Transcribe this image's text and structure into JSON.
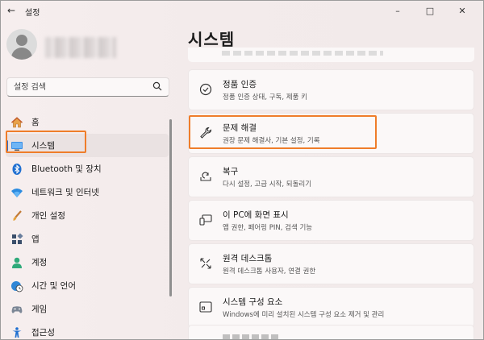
{
  "window": {
    "title": "설정"
  },
  "search": {
    "placeholder": "설정 검색"
  },
  "sidebar": {
    "items": [
      {
        "label": "홈",
        "icon": "home-icon",
        "active": false
      },
      {
        "label": "시스템",
        "icon": "system-display-icon",
        "active": true
      },
      {
        "label": "Bluetooth 및 장치",
        "icon": "bluetooth-icon",
        "active": false
      },
      {
        "label": "네트워크 및 인터넷",
        "icon": "wifi-icon",
        "active": false
      },
      {
        "label": "개인 설정",
        "icon": "brush-icon",
        "active": false
      },
      {
        "label": "앱",
        "icon": "apps-icon",
        "active": false
      },
      {
        "label": "계정",
        "icon": "account-icon",
        "active": false
      },
      {
        "label": "시간 및 언어",
        "icon": "globe-clock-icon",
        "active": false
      },
      {
        "label": "게임",
        "icon": "gamepad-icon",
        "active": false
      },
      {
        "label": "접근성",
        "icon": "accessibility-icon",
        "active": false
      }
    ]
  },
  "main": {
    "title": "시스템",
    "cards": [
      {
        "title": "정품 인증",
        "subtitle": "정품 인증 상태, 구독, 제품 키",
        "icon": "check-circle-icon"
      },
      {
        "title": "문제 해결",
        "subtitle": "권장 문제 해결사, 기본 설정, 기록",
        "icon": "wrench-icon"
      },
      {
        "title": "복구",
        "subtitle": "다시 설정, 고급 시작, 되돌리기",
        "icon": "recovery-icon"
      },
      {
        "title": "이 PC에 화면 표시",
        "subtitle": "앱 권한, 페어링 PIN, 검색 기능",
        "icon": "project-screen-icon"
      },
      {
        "title": "원격 데스크톱",
        "subtitle": "원격 데스크톱 사용자, 연결 권한",
        "icon": "remote-desktop-icon"
      },
      {
        "title": "시스템 구성 요소",
        "subtitle": "Windows에 미리 설치된 시스템 구성 요소 제거 및 관리",
        "icon": "system-components-icon"
      }
    ]
  },
  "colors": {
    "accent": "#2d6bc6",
    "highlight": "#ef7d2a"
  }
}
